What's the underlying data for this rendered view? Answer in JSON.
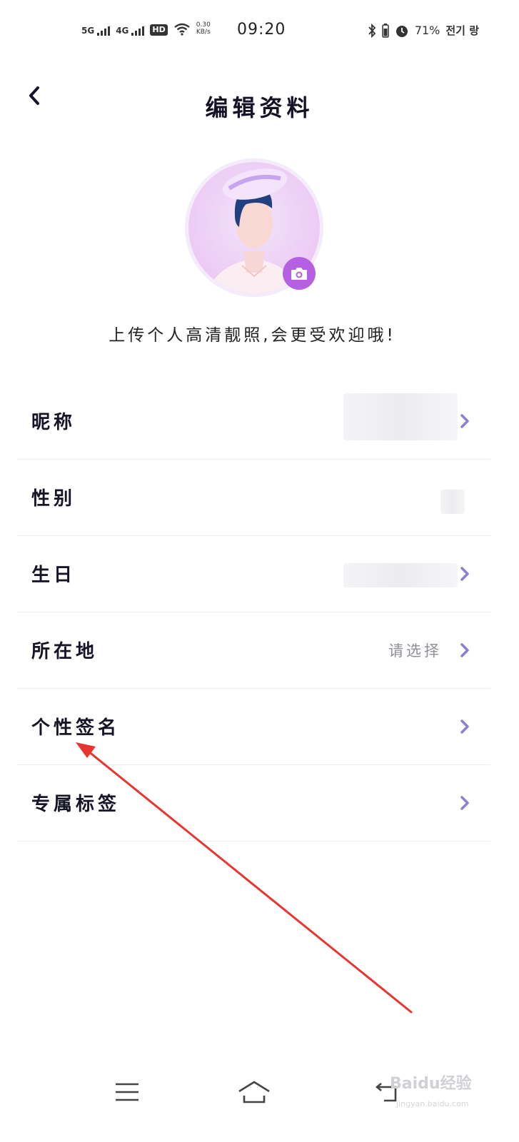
{
  "status_bar": {
    "sig1_label": "5G",
    "sig2_label": "4G",
    "hd_label": "HD",
    "speed_value": "0.30",
    "speed_unit": "KB/s",
    "time": "09:20",
    "battery": "71%",
    "carrier": "전기 랑"
  },
  "header": {
    "title": "编辑资料"
  },
  "profile": {
    "upload_hint": "上传个人高清靓照,会更受欢迎哦!"
  },
  "rows": [
    {
      "label": "昵称",
      "value": ""
    },
    {
      "label": "性别",
      "value": ""
    },
    {
      "label": "生日",
      "value": ""
    },
    {
      "label": "所在地",
      "value": "请选择"
    },
    {
      "label": "个性签名",
      "value": ""
    },
    {
      "label": "专属标签",
      "value": ""
    }
  ],
  "watermark": {
    "main": "Baidu经验",
    "sub": "jingyan.baidu.com"
  },
  "colors": {
    "accent_purple": "#b560e3",
    "chevron": "#8a7fd0",
    "annotation_arrow": "#e8352f"
  }
}
